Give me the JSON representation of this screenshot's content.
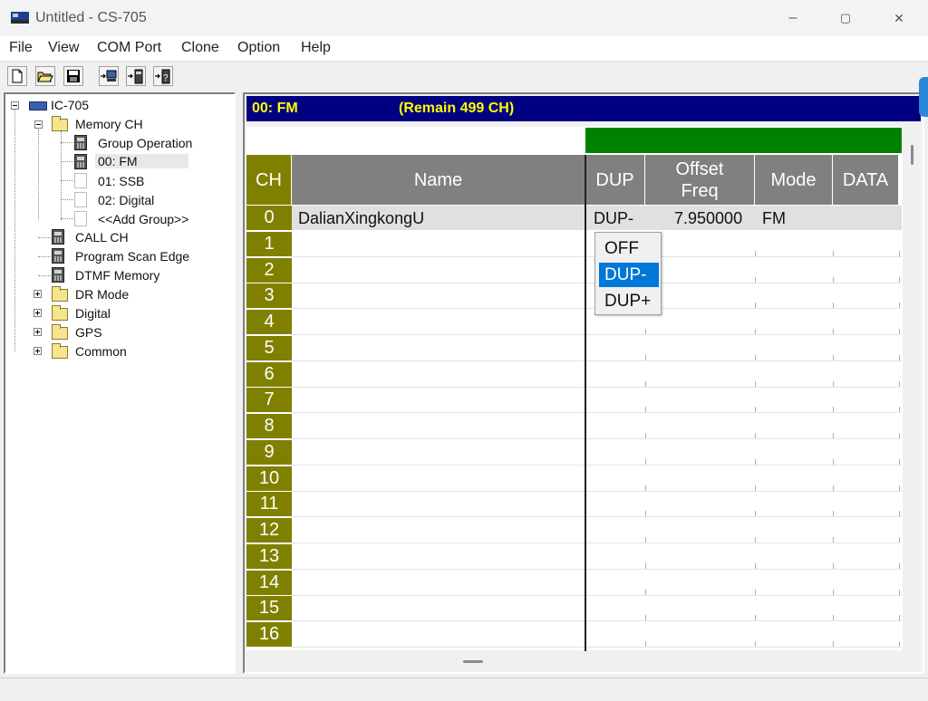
{
  "window": {
    "title": "Untitled - CS-705",
    "controls": {
      "minimize": "–",
      "maximize": "▢",
      "close": "✕"
    }
  },
  "menu": [
    "File",
    "View",
    "COM Port",
    "Clone",
    "Option",
    "Help"
  ],
  "toolbar": {
    "buttons": [
      "new-document-icon",
      "open-folder-icon",
      "save-icon",
      "read-from-radio-icon",
      "write-to-radio-icon",
      "radio-info-icon"
    ]
  },
  "tree": {
    "root": "IC-705",
    "memory_ch": "Memory CH",
    "group_operation": "Group Operation",
    "fm": "00: FM",
    "ssb": "01: SSB",
    "digital_group": "02: Digital",
    "add_group": "<<Add Group>>",
    "call_ch": "CALL CH",
    "program_scan_edge": "Program Scan Edge",
    "dtmf_memory": "DTMF Memory",
    "dr_mode": "DR Mode",
    "digital": "Digital",
    "gps": "GPS",
    "common": "Common"
  },
  "header": {
    "group": "00: FM",
    "remain": "(Remain  499 CH)"
  },
  "table": {
    "columns": {
      "ch": "CH",
      "name": "Name",
      "dup": "DUP",
      "offset_line1": "Offset",
      "offset_line2": "Freq",
      "mode": "Mode",
      "data": "DATA"
    },
    "rows": [
      {
        "ch": "0",
        "name": "DalianXingkongU",
        "dup": "DUP-",
        "offset": "7.950000",
        "mode": "FM"
      },
      {
        "ch": "1"
      },
      {
        "ch": "2"
      },
      {
        "ch": "3"
      },
      {
        "ch": "4"
      },
      {
        "ch": "5"
      },
      {
        "ch": "6"
      },
      {
        "ch": "7"
      },
      {
        "ch": "8"
      },
      {
        "ch": "9"
      },
      {
        "ch": "10"
      },
      {
        "ch": "11"
      },
      {
        "ch": "12"
      },
      {
        "ch": "13"
      },
      {
        "ch": "14"
      },
      {
        "ch": "15"
      },
      {
        "ch": "16"
      }
    ]
  },
  "dup_dropdown": {
    "options": [
      "OFF",
      "DUP-",
      "DUP+"
    ],
    "selected": "DUP-"
  },
  "colors": {
    "header_bg": "#000080",
    "header_text": "#ffff00",
    "ch_column": "#808000",
    "column_header": "#808080",
    "group_band": "#008000",
    "selection": "#0078d7"
  }
}
